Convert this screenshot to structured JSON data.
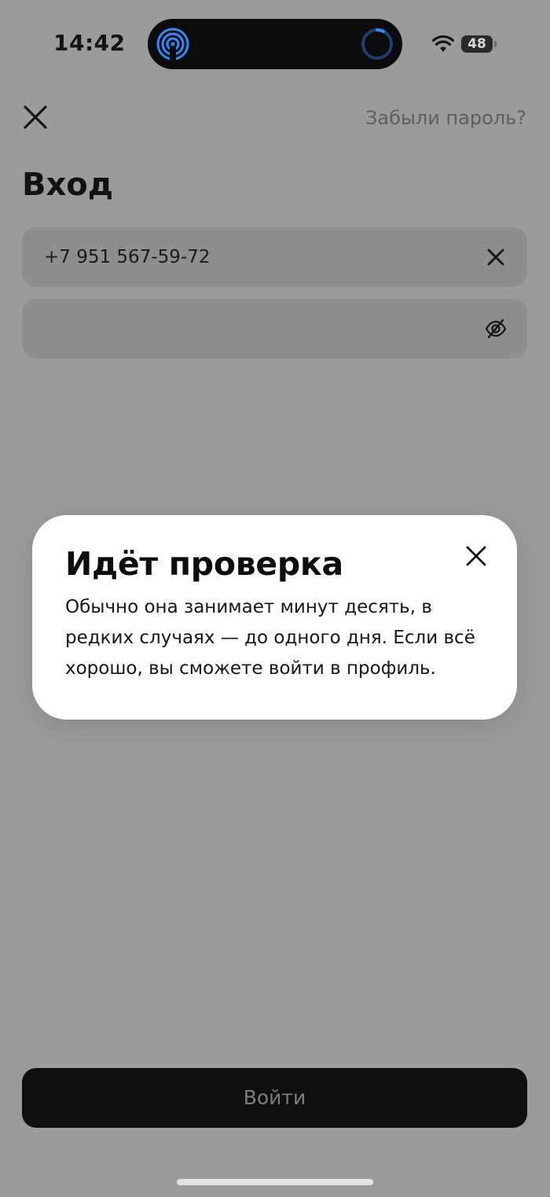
{
  "status_bar": {
    "time": "14:42",
    "battery": "48",
    "left_activity_icon": "airdrop-broadcast-icon",
    "right_activity_icon": "progress-ring-icon",
    "accent_color": "#2f8cff"
  },
  "header": {
    "close_icon": "close-icon",
    "forgot_password": "Забыли пароль?",
    "title": "Вход"
  },
  "form": {
    "phone": {
      "value": "+7 951 567-59-72",
      "clear_icon": "clear-icon"
    },
    "password": {
      "value": "",
      "visibility_icon": "eye-off-icon"
    }
  },
  "dialog": {
    "title": "Идёт проверка",
    "text": "Обычно она занимает минут десять, в редких случаях — до одного дня. Если всё хорошо, вы сможете войти в профиль.",
    "close_icon": "close-icon"
  },
  "actions": {
    "login_label": "Войти"
  },
  "colors": {
    "overlay_background": "#9b9b9b",
    "field_background": "#8e8e8e",
    "button_background": "#0f0f0f",
    "dialog_background": "#ffffff"
  }
}
